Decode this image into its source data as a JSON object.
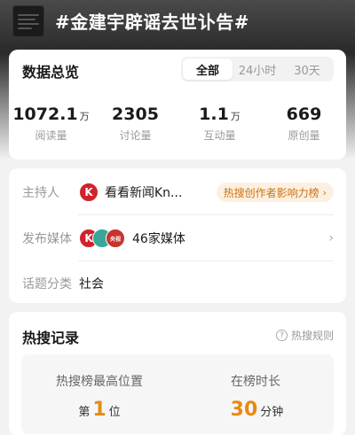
{
  "header": {
    "topic_title": "#金建宇辟谣去世讣告#"
  },
  "overview": {
    "title": "数据总览",
    "tabs": [
      {
        "label": "全部",
        "active": true
      },
      {
        "label": "24小时",
        "active": false
      },
      {
        "label": "30天",
        "active": false
      }
    ],
    "stats": [
      {
        "value": "1072.1",
        "unit": "万",
        "label": "阅读量"
      },
      {
        "value": "2305",
        "unit": "",
        "label": "讨论量"
      },
      {
        "value": "1.1",
        "unit": "万",
        "label": "互动量"
      },
      {
        "value": "669",
        "unit": "",
        "label": "原创量"
      }
    ]
  },
  "info": {
    "host": {
      "key": "主持人",
      "name": "看看新闻Kn...",
      "logo_letter": "K",
      "badge": "热搜创作者影响力榜",
      "badge_arrow": "›"
    },
    "media": {
      "key": "发布媒体",
      "logo_letters": [
        "K",
        "",
        "央视"
      ],
      "count": "46家媒体",
      "chevron": "›"
    },
    "category": {
      "key": "话题分类",
      "value": "社会"
    }
  },
  "hot_record": {
    "title": "热搜记录",
    "rules_label": "热搜规则",
    "help_icon": "?",
    "highest": {
      "label": "热搜榜最高位置",
      "prefix": "第",
      "value": "1",
      "suffix": "位"
    },
    "duration": {
      "label": "在榜时长",
      "value": "30",
      "suffix": "分钟"
    }
  },
  "colors": {
    "accent_orange": "#e88a12",
    "badge_text": "#c87414",
    "badge_bg": "#fdf0e0",
    "logo_red": "#d0232c"
  }
}
